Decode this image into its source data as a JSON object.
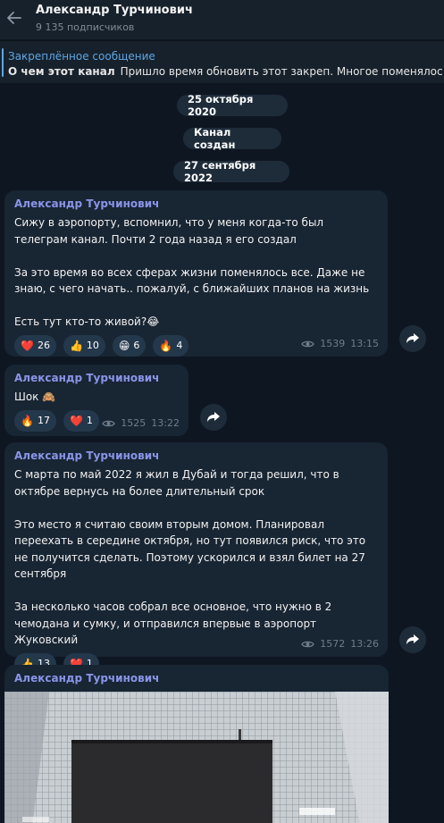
{
  "header": {
    "title": "Александр Турчинович",
    "subscribers": "9 135 подписчиков"
  },
  "pinned": {
    "label": "Закреплённое сообщение",
    "bold": "О чем этот канал",
    "text": "Пришло время обновить этот закреп. Многое поменялось"
  },
  "pills": {
    "date1": "25 октября 2020",
    "channel_created": "Канал создан",
    "date2": "27 сентября 2022"
  },
  "messages": [
    {
      "author": "Александр Турчинович",
      "paragraphs": [
        "Сижу в аэропорту, вспомнил, что у меня когда-то был телеграм канал. Почти 2 года назад я его создал",
        "За это время во всех сферах жизни поменялось все. Даже не знаю, с чего начать.. пожалуй, с ближайших планов на жизнь",
        "Есть тут кто-то живой?😂"
      ],
      "reactions": [
        {
          "emoji": "❤️",
          "count": "26"
        },
        {
          "emoji": "👍",
          "count": "10"
        },
        {
          "emoji": "😁",
          "count": "6"
        },
        {
          "emoji": "🔥",
          "count": "4"
        }
      ],
      "views": "1539",
      "time": "13:15"
    },
    {
      "author": "Александр Турчинович",
      "paragraphs": [
        "Шок 🙈"
      ],
      "reactions": [
        {
          "emoji": "🔥",
          "count": "17"
        },
        {
          "emoji": "❤️",
          "count": "1"
        }
      ],
      "views": "1525",
      "time": "13:22"
    },
    {
      "author": "Александр Турчинович",
      "paragraphs": [
        "С марта по май 2022 я жил в Дубай и тогда решил, что в октябре вернусь на более длительный срок",
        "Это место я считаю своим вторым домом. Планировал переехать в середине октября, но тут появился риск, что это не получится сделать. Поэтому ускорился и взял билет на 27 сентября",
        "За несколько часов собрал все основное, что нужно в 2 чемодана и сумку, и отправился впервые в аэропорт Жуковский"
      ],
      "reactions": [
        {
          "emoji": "👍",
          "count": "13"
        },
        {
          "emoji": "❤️",
          "count": "1"
        }
      ],
      "views": "1572",
      "time": "13:26"
    },
    {
      "author": "Александр Турчинович"
    }
  ],
  "icons": {
    "back": "arrow-left-icon",
    "views": "eye-icon",
    "share": "share-arrow-icon"
  },
  "colors": {
    "background": "#0e1621",
    "bubble": "#182533",
    "accent": "#5ea6e3",
    "author": "#8a95e8"
  }
}
